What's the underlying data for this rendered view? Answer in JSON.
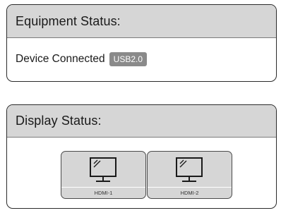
{
  "equipment_status": {
    "title": "Equipment Status:",
    "device_text": "Device Connected",
    "connection_badge": "USB2.0"
  },
  "display_status": {
    "title": "Display Status:",
    "ports": [
      {
        "label": "HDMI-1",
        "icon": "monitor-icon"
      },
      {
        "label": "HDMI-2",
        "icon": "monitor-icon"
      }
    ]
  },
  "colors": {
    "header_bg": "#d6d6d6",
    "badge_bg": "#8a8a8a",
    "border": "#2a2a2a"
  }
}
